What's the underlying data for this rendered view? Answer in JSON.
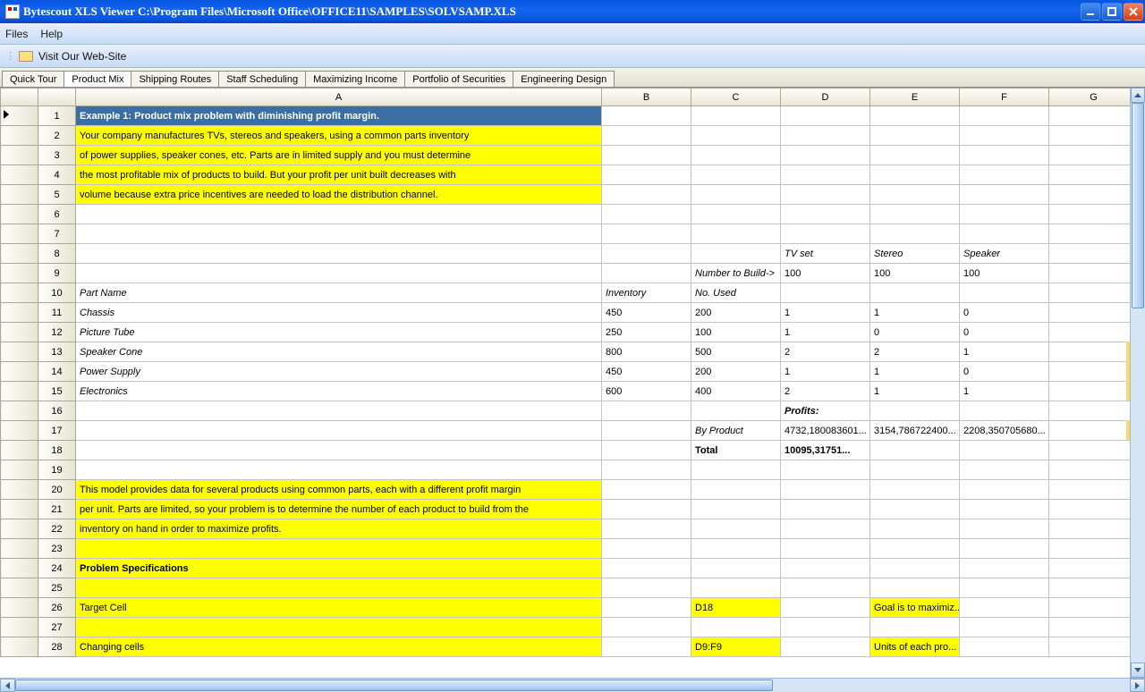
{
  "titlebar": {
    "title": "Bytescout XLS Viewer C:\\Program Files\\Microsoft Office\\OFFICE11\\SAMPLES\\SOLVSAMP.XLS"
  },
  "menu": {
    "files": "Files",
    "help": "Help"
  },
  "toolbar": {
    "visit": "Visit Our Web-Site"
  },
  "tabs": [
    "Quick Tour",
    "Product Mix",
    "Shipping Routes",
    "Staff Scheduling",
    "Maximizing Income",
    "Portfolio of Securities",
    "Engineering Design"
  ],
  "active_tab_index": 1,
  "columns": [
    "A",
    "B",
    "C",
    "D",
    "E",
    "F",
    "G"
  ],
  "rows": [
    {
      "n": 1,
      "cls": "hdr-title",
      "cells": {
        "A": "Example 1:  Product mix problem with diminishing profit margin."
      }
    },
    {
      "n": 2,
      "cls": "yellow",
      "cells": {
        "A": "Your company manufactures TVs, stereos and speakers, using a common parts inventory"
      }
    },
    {
      "n": 3,
      "cls": "yellow",
      "cells": {
        "A": "of power supplies, speaker cones, etc.  Parts are in limited supply and you must determine"
      }
    },
    {
      "n": 4,
      "cls": "yellow",
      "cells": {
        "A": "the most profitable mix of products to build. But your profit per unit built decreases with"
      }
    },
    {
      "n": 5,
      "cls": "yellow",
      "cells": {
        "A": "volume because extra price incentives are needed to load the distribution channel."
      }
    },
    {
      "n": 6,
      "cells": {}
    },
    {
      "n": 7,
      "cells": {}
    },
    {
      "n": 8,
      "cells": {
        "D": {
          "t": "TV set",
          "s": "italic"
        },
        "E": {
          "t": "Stereo",
          "s": "italic"
        },
        "F": {
          "t": "Speaker",
          "s": "italic"
        }
      }
    },
    {
      "n": 9,
      "cells": {
        "C": {
          "t": "Number to Build->",
          "s": "italic"
        },
        "D": "100",
        "E": "100",
        "F": "100"
      }
    },
    {
      "n": 10,
      "cells": {
        "A": {
          "t": "Part Name",
          "s": "italic"
        },
        "B": {
          "t": "Inventory",
          "s": "italic"
        },
        "C": {
          "t": "No. Used",
          "s": "italic"
        }
      }
    },
    {
      "n": 11,
      "cells": {
        "A": {
          "t": "Chassis",
          "s": "italic"
        },
        "B": "450",
        "C": "200",
        "D": "1",
        "E": "1",
        "F": "0"
      }
    },
    {
      "n": 12,
      "cells": {
        "A": {
          "t": "Picture Tube",
          "s": "italic"
        },
        "B": "250",
        "C": "100",
        "D": "1",
        "E": "0",
        "F": "0"
      }
    },
    {
      "n": 13,
      "cells": {
        "A": {
          "t": "Speaker Cone",
          "s": "italic"
        },
        "B": "800",
        "C": "500",
        "D": "2",
        "E": "2",
        "F": "1"
      }
    },
    {
      "n": 14,
      "cells": {
        "A": {
          "t": "Power Supply",
          "s": "italic"
        },
        "B": "450",
        "C": "200",
        "D": "1",
        "E": "1",
        "F": "0"
      }
    },
    {
      "n": 15,
      "cells": {
        "A": {
          "t": "Electronics",
          "s": "italic"
        },
        "B": "600",
        "C": "400",
        "D": "2",
        "E": "1",
        "F": "1"
      }
    },
    {
      "n": 16,
      "cells": {
        "D": {
          "t": "Profits:",
          "s": "bolditalic"
        }
      }
    },
    {
      "n": 17,
      "cells": {
        "C": {
          "t": "By Product",
          "s": "italic"
        },
        "D": "4732,180083601...",
        "E": "3154,786722400...",
        "F": "2208,350705680..."
      }
    },
    {
      "n": 18,
      "cells": {
        "C": {
          "t": "Total",
          "s": "bold"
        },
        "D": {
          "t": "10095,31751...",
          "s": "bold"
        }
      }
    },
    {
      "n": 19,
      "cells": {}
    },
    {
      "n": 20,
      "cls": "yellow",
      "cells": {
        "A": "This model provides data for several products using common parts, each with a different profit margin"
      }
    },
    {
      "n": 21,
      "cls": "yellow",
      "cells": {
        "A": "per unit.  Parts are limited, so your problem is to determine the number of each product to build from the"
      }
    },
    {
      "n": 22,
      "cls": "yellow",
      "cells": {
        "A": "inventory on hand in order to maximize profits."
      }
    },
    {
      "n": 23,
      "cls": "yellow",
      "cells": {}
    },
    {
      "n": 24,
      "cls": "yellow",
      "cells": {
        "A": {
          "t": "Problem Specifications",
          "s": "bold"
        }
      }
    },
    {
      "n": 25,
      "cls": "yellow",
      "cells": {}
    },
    {
      "n": 26,
      "cls": "yellow",
      "cells": {
        "A": "Target Cell",
        "C": "D18",
        "E": "Goal is to maximiz..."
      }
    },
    {
      "n": 27,
      "cls": "yellow",
      "cells": {}
    },
    {
      "n": 28,
      "cls": "yellow",
      "cells": {
        "A": "Changing cells",
        "C": "D9:F9",
        "E": "Units of each pro..."
      }
    }
  ]
}
